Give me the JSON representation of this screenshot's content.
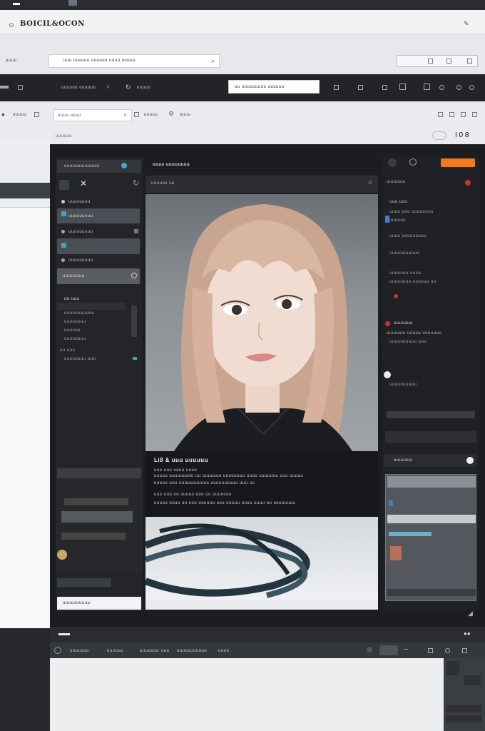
{
  "app": {
    "title": "BOICIL&OCON"
  },
  "top_search": {
    "placeholder": "uuu uuuuuu uuuuuu uuuu uuuuu"
  },
  "top_left_label": "uuuu",
  "toolbar": {
    "crumbs": [
      "uuuuuu uuuuuu",
      "uuuuu"
    ],
    "field_value": "uu uuuuuuuuu uuuuuu"
  },
  "filter": {
    "left_label": "uuuuu",
    "input_value": "uuuu uuuu",
    "tags": [
      "uuuuu",
      "uuuu"
    ]
  },
  "subcaption": "uuuuuu",
  "panel_left": {
    "header": "uuuuuuuuuuuuu",
    "items": [
      "uuuuuuuu",
      "uuuuuuuuu",
      "uuuuuuuuu",
      "uuuuuuuuu"
    ],
    "group": "uu uuu",
    "subitems": [
      "uuuuuuuuuuu",
      "uuuuuuuu",
      "uuuuuu",
      "uuuuuuuu",
      "uu uuu",
      "uuuuuuuu uuu"
    ],
    "footer": "uuuuuuuuuu"
  },
  "main": {
    "title": "uuuu uuuuuuuu",
    "search": "uuuuuu uu",
    "caption_title": "Li8 & uuu uuuuuu",
    "caption_lines": [
      "uuu uuu uuuu uuuu",
      "uuuuu uuuuuuuuu uu uuuuuuu uuuuuuuu uuuu uuuuuuu uuu uuuuu",
      "uuuuu uuu uuuuuuuuuuu uuuuuuuuuu uuu uu",
      "uuu uuu uu uuuuu uuu uu uuuuuuu",
      "uuuuu uuuu uu uuu uuuuuu uuu uuuuu uuuu uuuu uu uuuuuuuu"
    ]
  },
  "panel_right": {
    "header": "uuuuuuu",
    "items": [
      "uuu uuu",
      "uuuu uuu uuuuuuuu",
      "uuuuuu",
      "uuuu uuuuuuuuu",
      "uuuuuuuuuuu",
      "uuuuuuu uuuu",
      "uuuuuuuu uuuuuu uu"
    ],
    "section": "uuuuuuu",
    "section_items": [
      "uuuuuuu uuuuu uuuuuuu",
      "uuuuuuuuuu uuu",
      "uuuuuuuuuu"
    ],
    "preview_label": "uuuuuuu"
  },
  "bottom_bar": {
    "items": [
      "uuuuuuu",
      "uuuuuu",
      "uuu",
      "uuuuuuuuuuu",
      "uuuu"
    ]
  },
  "accent": "#f07a1d"
}
